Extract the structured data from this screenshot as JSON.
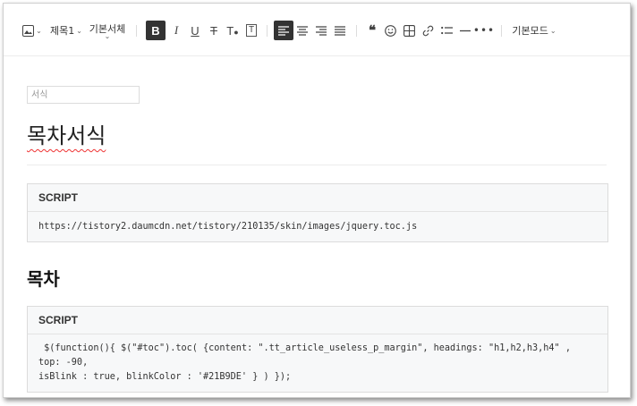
{
  "toolbar": {
    "heading_label": "제목1",
    "font_label": "기본서체",
    "mode_label": "기본모드"
  },
  "editor": {
    "category_placeholder": "서식",
    "doc_title": "목차서식",
    "blocks": [
      {
        "header": "SCRIPT",
        "code": "https://tistory2.daumcdn.net/tistory/210135/skin/images/jquery.toc.js"
      },
      {
        "header": "SCRIPT",
        "code": " $(function(){ $(\"#toc\").toc( {content: \".tt_article_useless_p_margin\", headings: \"h1,h2,h3,h4\" , top: -90,\nisBlink : true, blinkColor : '#21B9DE' } ) });"
      }
    ],
    "section_heading": "목차"
  },
  "colors": {
    "active_button_bg": "#333333",
    "code_bg": "#f7f8f9"
  }
}
